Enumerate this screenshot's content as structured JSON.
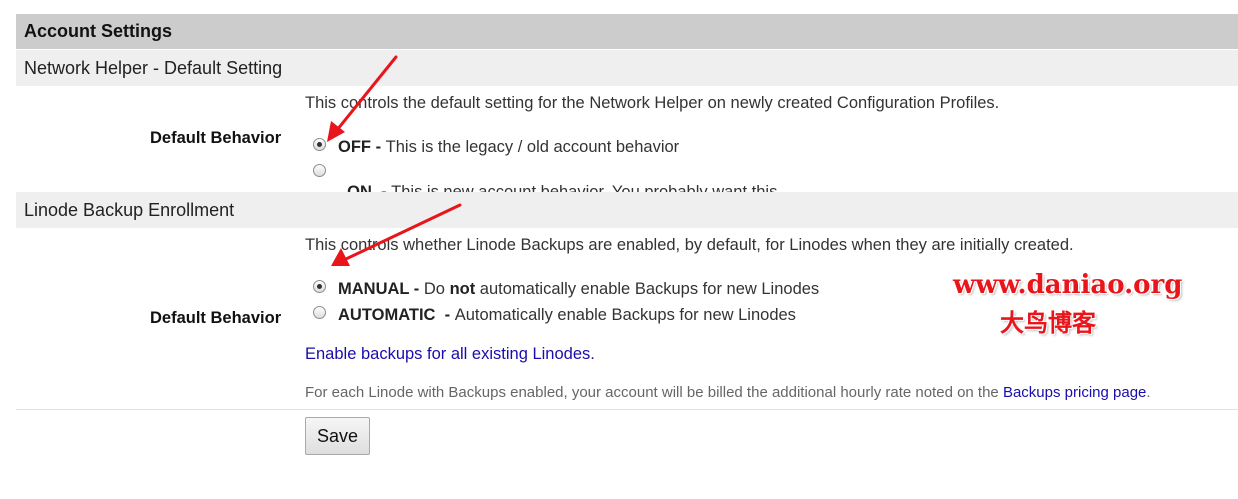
{
  "header": {
    "title": "Account Settings"
  },
  "network_helper": {
    "section_title": "Network Helper - Default Setting",
    "description": "This controls the default setting for the Network Helper on newly created Configuration Profiles.",
    "field_label": "Default Behavior",
    "options": [
      {
        "name": "OFF",
        "separator": " - ",
        "text": "This is the legacy / old account behavior",
        "checked": true
      },
      {
        "name": "ON",
        "separator": "  - ",
        "text": "This is new account behavior. You probably want this.",
        "checked": false
      }
    ]
  },
  "backup_enrollment": {
    "section_title": "Linode Backup Enrollment",
    "description": "This controls whether Linode Backups are enabled, by default, for Linodes when they are initially created.",
    "field_label": "Default Behavior",
    "options": [
      {
        "name": "MANUAL",
        "separator": " - ",
        "text_pre": "Do ",
        "text_bold": "not",
        "text_post": " automatically enable Backups for new Linodes",
        "checked": true
      },
      {
        "name": "AUTOMATIC",
        "separator": "  - ",
        "text": "Automatically enable Backups for new Linodes",
        "checked": false
      }
    ],
    "enable_all_link": "Enable backups for all existing Linodes.",
    "billing_note": "For each Linode with Backups enabled, your account will be billed the additional hourly rate noted on the ",
    "pricing_link": "Backups pricing page",
    "note_end": "."
  },
  "actions": {
    "save_label": "Save"
  },
  "watermark": {
    "line1": "www.daniao.org",
    "line2": "大鸟博客"
  },
  "colors": {
    "header_bg": "#cccccc",
    "section_bg": "#efefef",
    "link": "#1a0dab",
    "annotation_red": "#e8151b"
  }
}
